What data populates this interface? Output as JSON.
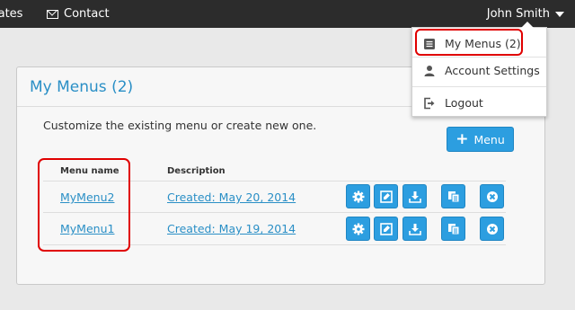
{
  "topbar": {
    "updates_label": "lates",
    "contact_label": "Contact",
    "user_name": "John Smith"
  },
  "dropdown": {
    "items": [
      {
        "label": "My Menus (2)",
        "icon": "menus-icon"
      },
      {
        "label": "Account Settings",
        "icon": "user-icon"
      },
      {
        "label": "Logout",
        "icon": "logout-icon"
      }
    ]
  },
  "panel": {
    "title": "My Menus (2)",
    "intro": "Customize the existing menu or create new one.",
    "add_button_label": "Menu"
  },
  "table": {
    "headers": [
      "Menu name",
      "Description"
    ],
    "rows": [
      {
        "name": "MyMenu2",
        "description": "Created: May 20, 2014"
      },
      {
        "name": "MyMenu1",
        "description": "Created: May 19, 2014"
      }
    ],
    "action_icons": [
      "gear-icon",
      "edit-icon",
      "download-icon",
      "copy-icon",
      "delete-icon"
    ]
  },
  "colors": {
    "accent": "#2c9ee0",
    "link": "#2a8fc6",
    "highlight": "#e00000",
    "topbar": "#2c2c2c"
  }
}
